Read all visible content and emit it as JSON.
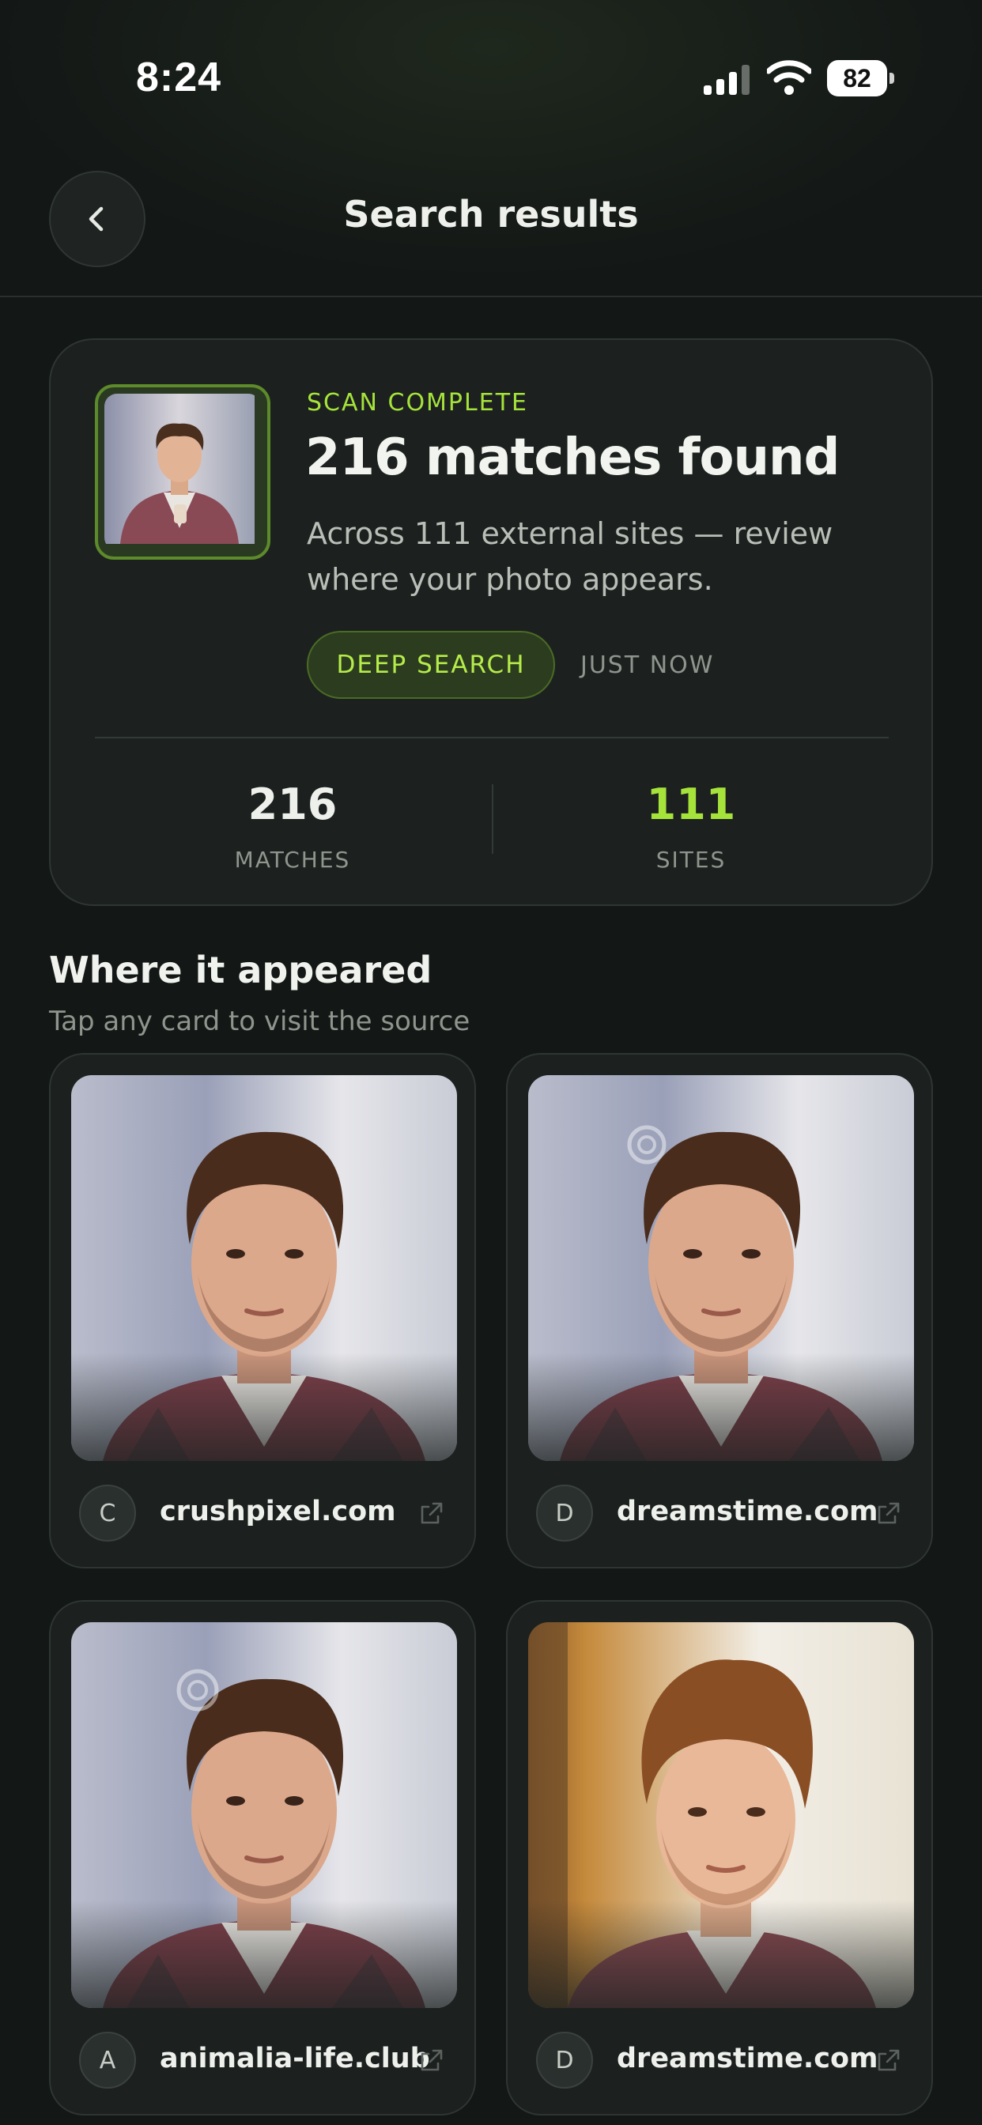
{
  "status_bar": {
    "time": "8:24",
    "battery": "82"
  },
  "header": {
    "title": "Search results"
  },
  "summary": {
    "scan_label": "SCAN COMPLETE",
    "heading": "216 matches found",
    "description": "Across 111 external sites — review where your photo appears.",
    "deep_search_label": "DEEP SEARCH",
    "time_label": "JUST NOW",
    "stats": {
      "matches_value": "216",
      "matches_label": "MATCHES",
      "sites_value": "111",
      "sites_label": "SITES"
    }
  },
  "section": {
    "title": "Where it appeared",
    "subtitle": "Tap any card to visit the source"
  },
  "results": [
    {
      "badge": "C",
      "domain": "crushpixel.com"
    },
    {
      "badge": "D",
      "domain": "dreamstime.com"
    },
    {
      "badge": "A",
      "domain": "animalia-life.club"
    },
    {
      "badge": "D",
      "domain": "dreamstime.com"
    }
  ],
  "colors": {
    "accent": "#a6e33a",
    "background": "#131716",
    "card": "#1c2120"
  }
}
